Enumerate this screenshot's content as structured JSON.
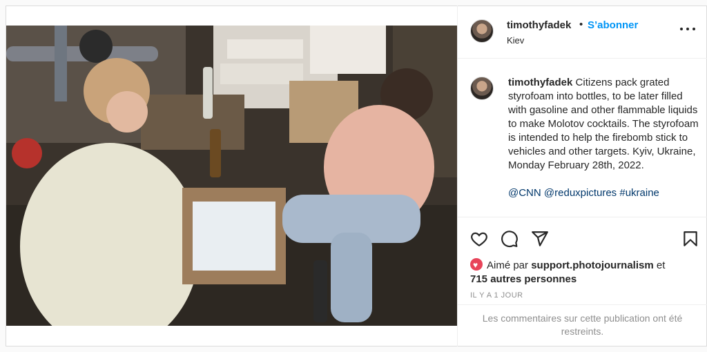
{
  "post": {
    "username": "timothyfadek",
    "separator": "•",
    "follow_label": "S’abonner",
    "location": "Kiev",
    "photo_alt": "Citizens packing styrofoam into bottles in a basement",
    "caption": {
      "username": "timothyfadek",
      "text": "Citizens pack grated styrofoam into bottles, to be later filled with gasoline and other flammable liquids to make Molotov cocktails. The styrofoam is intended to help the firebomb stick to vehicles and other targets. Kyiv, Ukraine, Monday February 28th, 2022.",
      "tags": [
        "@CNN",
        "@reduxpictures",
        "#ukraine"
      ]
    },
    "actions": {
      "like_icon": "heart-icon",
      "comment_icon": "comment-icon",
      "share_icon": "paper-plane-icon",
      "save_icon": "bookmark-icon"
    },
    "likes": {
      "prefix": "Aimé par",
      "liked_by": "support.photojournalism",
      "conjunction": "et",
      "others": "715 autres personnes"
    },
    "timestamp": "IL Y A 1 JOUR",
    "comments_restricted": "Les commentaires sur cette publication ont été restreints.",
    "colors": {
      "follow": "#0095f6",
      "tag": "#00376b",
      "muted": "#8e8e8e",
      "like_badge": "#e8445a"
    }
  }
}
